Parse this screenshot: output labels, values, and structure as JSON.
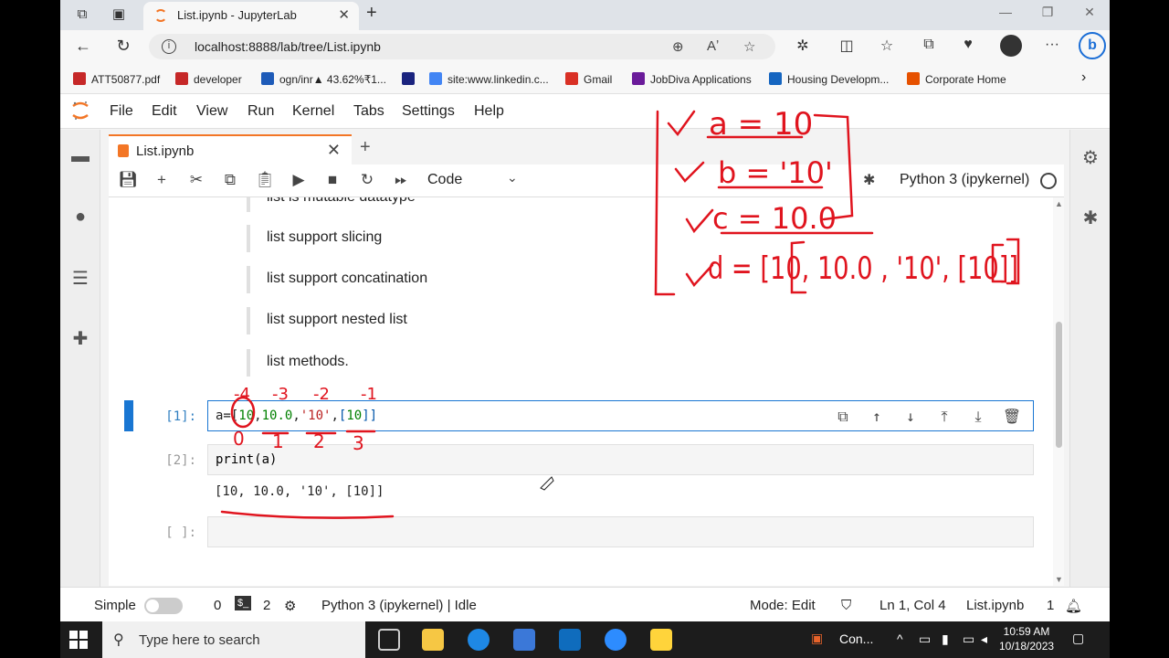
{
  "browser": {
    "tab_title": "List.ipynb - JupyterLab",
    "url": "localhost:8888/lab/tree/List.ipynb",
    "bookmarks": [
      {
        "label": "ATT50877.pdf",
        "color": "#c62828"
      },
      {
        "label": "developer",
        "color": "#c62828"
      },
      {
        "label": "ogn/inr▲ 43.62%₹1...",
        "color": "#1e5bb8"
      },
      {
        "label": "",
        "color": "#1a237e"
      },
      {
        "label": "site:www.linkedin.c...",
        "color": "#4285f4"
      },
      {
        "label": "Gmail",
        "color": "#d93025"
      },
      {
        "label": "JobDiva Applications",
        "color": "#6a1b9a"
      },
      {
        "label": "Housing Developm...",
        "color": "#1565c0"
      },
      {
        "label": "Corporate Home",
        "color": "#e65100"
      }
    ]
  },
  "jupyter": {
    "menu": [
      "File",
      "Edit",
      "View",
      "Run",
      "Kernel",
      "Tabs",
      "Settings",
      "Help"
    ],
    "doc_tab": "List.ipynb",
    "cell_type": "Code",
    "kernel": "Python 3 (ipykernel)"
  },
  "notebook": {
    "markdown_lines": [
      "list is mutable datatype",
      "list support slicing",
      "list support concatination",
      "list support nested list",
      "list methods."
    ],
    "cells": [
      {
        "prompt": "[1]:",
        "code_parts": [
          "a=[",
          "10",
          ",",
          "10.0",
          ",",
          "'10'",
          ",",
          "[",
          "10",
          "]]"
        ]
      },
      {
        "prompt": "[2]:",
        "code": "print(a)",
        "output": "[10, 10.0, '10', [10]]"
      },
      {
        "prompt": "[ ]:",
        "code": ""
      }
    ]
  },
  "statusbar": {
    "mode_label": "Simple",
    "zero": "0",
    "terminals": "2",
    "kernel_status": "Python 3 (ipykernel) | Idle",
    "mode": "Mode: Edit",
    "position": "Ln 1, Col 4",
    "filename": "List.ipynb",
    "count": "1"
  },
  "taskbar": {
    "search_placeholder": "Type here to search",
    "con_label": "Con...",
    "time": "10:59 AM",
    "date": "10/18/2023"
  },
  "annotations": {
    "a": "a = 10",
    "b": "b = '10'",
    "c": "c = 10.0",
    "d": "d = [10, 10.0 , '10', [10]]",
    "index_neg": [
      "-4",
      "-3",
      "-2",
      "-1"
    ],
    "index_pos": [
      "0",
      "1",
      "2",
      "3"
    ]
  },
  "colors": {
    "accent": "#f37626",
    "active_cell": "#1976d2",
    "ink": "#e0141e"
  }
}
